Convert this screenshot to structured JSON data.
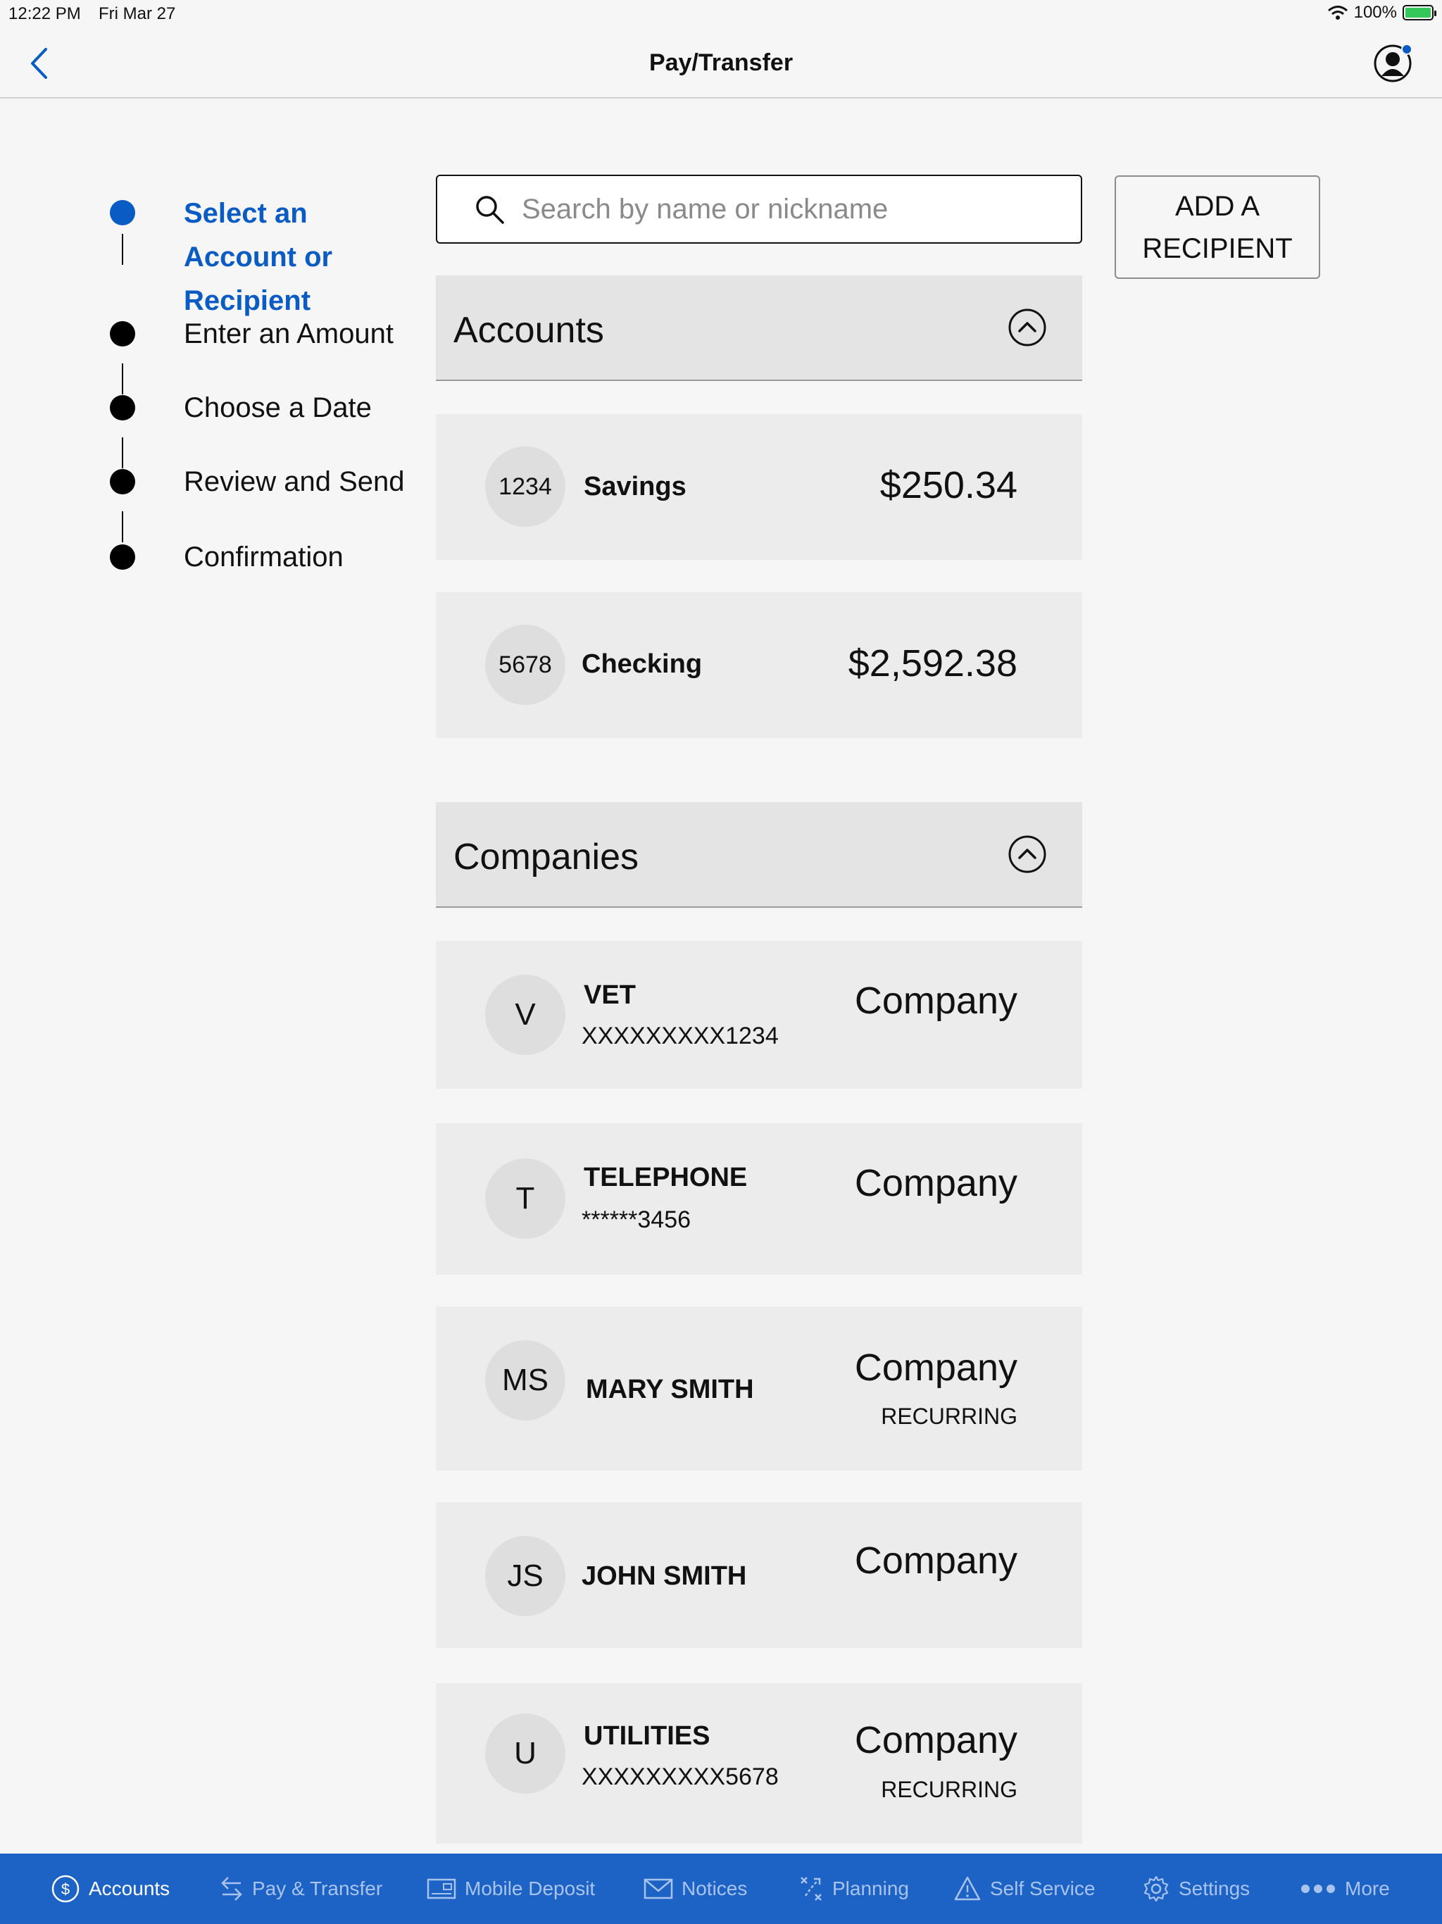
{
  "status": {
    "time": "12:22 PM",
    "date": "Fri Mar 27",
    "battery": "100%"
  },
  "header": {
    "title": "Pay/Transfer"
  },
  "stepper": {
    "steps": [
      {
        "label": "Select an Account or Recipient",
        "active": true
      },
      {
        "label": "Enter an Amount",
        "active": false
      },
      {
        "label": "Choose a Date",
        "active": false
      },
      {
        "label": "Review and Send",
        "active": false
      },
      {
        "label": "Confirmation",
        "active": false
      }
    ]
  },
  "search": {
    "placeholder": "Search by name or nickname",
    "value": ""
  },
  "add_recipient": {
    "label": "ADD A RECIPIENT"
  },
  "accounts": {
    "title": "Accounts",
    "items": [
      {
        "initials": "1234",
        "name": "Savings",
        "amount": "$250.34"
      },
      {
        "initials": "5678",
        "name": "Checking",
        "amount": "$2,592.38"
      }
    ]
  },
  "companies": {
    "title": "Companies",
    "items": [
      {
        "initials": "V",
        "name": "VET",
        "sub": "XXXXXXXXX1234",
        "type": "Company",
        "tag": ""
      },
      {
        "initials": "T",
        "name": "TELEPHONE",
        "sub": "******3456",
        "type": "Company",
        "tag": ""
      },
      {
        "initials": "MS",
        "name": "MARY SMITH",
        "sub": "",
        "type": "Company",
        "tag": "RECURRING"
      },
      {
        "initials": "JS",
        "name": "JOHN SMITH",
        "sub": "",
        "type": "Company",
        "tag": ""
      },
      {
        "initials": "U",
        "name": "UTILITIES",
        "sub": "XXXXXXXXX5678",
        "type": "Company",
        "tag": "RECURRING"
      }
    ]
  },
  "tabbar": {
    "items": [
      {
        "label": "Accounts",
        "icon": "dollar-circle-icon",
        "active": true
      },
      {
        "label": "Pay & Transfer",
        "icon": "transfer-arrows-icon",
        "active": false
      },
      {
        "label": "Mobile Deposit",
        "icon": "check-deposit-icon",
        "active": false
      },
      {
        "label": "Notices",
        "icon": "envelope-icon",
        "active": false
      },
      {
        "label": "Planning",
        "icon": "planning-icon",
        "active": false
      },
      {
        "label": "Self Service",
        "icon": "warning-triangle-icon",
        "active": false
      },
      {
        "label": "Settings",
        "icon": "gear-icon",
        "active": false
      },
      {
        "label": "More",
        "icon": "more-dots-icon",
        "active": false
      }
    ]
  },
  "colors": {
    "accent": "#0a5bc4",
    "tabbar": "#1d62c5",
    "row_bg": "#ececec",
    "header_bg": "#e4e4e4"
  }
}
